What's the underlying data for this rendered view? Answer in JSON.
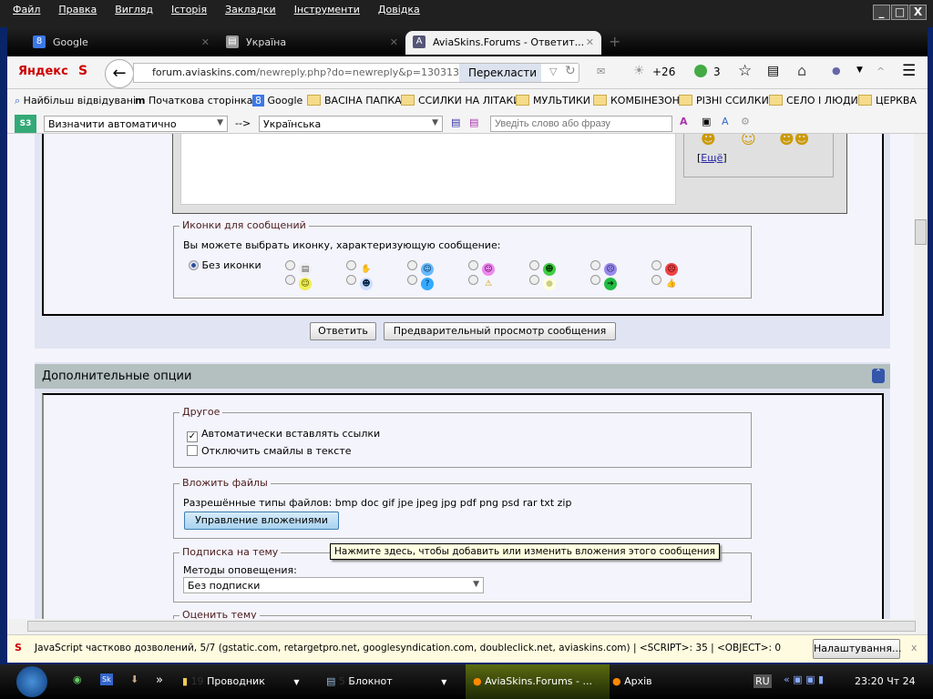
{
  "menu": [
    "Файл",
    "Правка",
    "Вигляд",
    "Історія",
    "Закладки",
    "Інструменти",
    "Довідка"
  ],
  "window_buttons": {
    "minimize": "_",
    "maximize": "□",
    "close": "X"
  },
  "tabs": [
    {
      "label": "Google"
    },
    {
      "label": "Україна"
    },
    {
      "label": "AviaSkins.Forums - Ответит..."
    }
  ],
  "new_tab": "+",
  "nav": {
    "yandex": "Яндекс",
    "url_domain": "forum.aviaskins.com",
    "url_path": "/newreply.php?do=newreply&p=130313",
    "translate": "Перекласти",
    "weather": "+26",
    "counter": "3"
  },
  "bookmarks": [
    "Найбільш відвідувані",
    "Початкова сторінка",
    "Google",
    "ВАСІНА ПАПКА",
    "ССИЛКИ НА ЛІТАКИ",
    "МУЛЬТИКИ",
    "КОМБІНЕЗОН",
    "РІЗНІ ССИЛКИ",
    "СЕЛО І ЛЮДИ",
    "ЦЕРКВА"
  ],
  "translator": {
    "from": "Визначити автоматично",
    "arrow": "-->",
    "to": "Українська",
    "placeholder": "Уведіть слово або фразу"
  },
  "smilies": {
    "more": "Ещё"
  },
  "icons_fieldset": {
    "legend": "Иконки для сообщений",
    "prompt": "Вы можете выбрать иконку, характеризующую сообщение:",
    "none": "Без иконки"
  },
  "buttons": {
    "reply": "Ответить",
    "preview": "Предварительный просмотр сообщения"
  },
  "options": {
    "title": "Дополнительные опции",
    "other": {
      "legend": "Другое",
      "auto_links": "Автоматически вставлять ссылки",
      "auto_links_checked": true,
      "disable_smilies": "Отключить смайлы в тексте",
      "disable_smilies_checked": false
    },
    "attach": {
      "legend": "Вложить файлы",
      "types": "Разрешённые типы файлов: bmp doc gif jpe jpeg jpg pdf png psd rar txt zip",
      "manage": "Управление вложениями"
    },
    "subscribe": {
      "legend": "Подписка на тему",
      "label": "Методы оповещения:",
      "value": "Без подписки"
    },
    "rate": {
      "legend": "Оценить тему"
    },
    "tooltip": "Нажмите здесь, чтобы добавить или изменить вложения этого сообщения"
  },
  "notification": {
    "text": "JavaScript частково дозволений, 5/7 (gstatic.com, retargetpro.net, googlesyndication.com, doubleclick.net, aviaskins.com) | <SCRIPT>: 35 | <OBJECT>: 0",
    "settings": "Налаштування...",
    "close": "x"
  },
  "taskbar": {
    "more": "»",
    "explorer": "Проводник",
    "explorer_count": "19",
    "notepad": "Блокнот",
    "notepad_count": "5",
    "firefox": "AviaSkins.Forums - ...",
    "archive": "Архів",
    "lang": "RU",
    "clock": "23:20 Чт 24"
  }
}
